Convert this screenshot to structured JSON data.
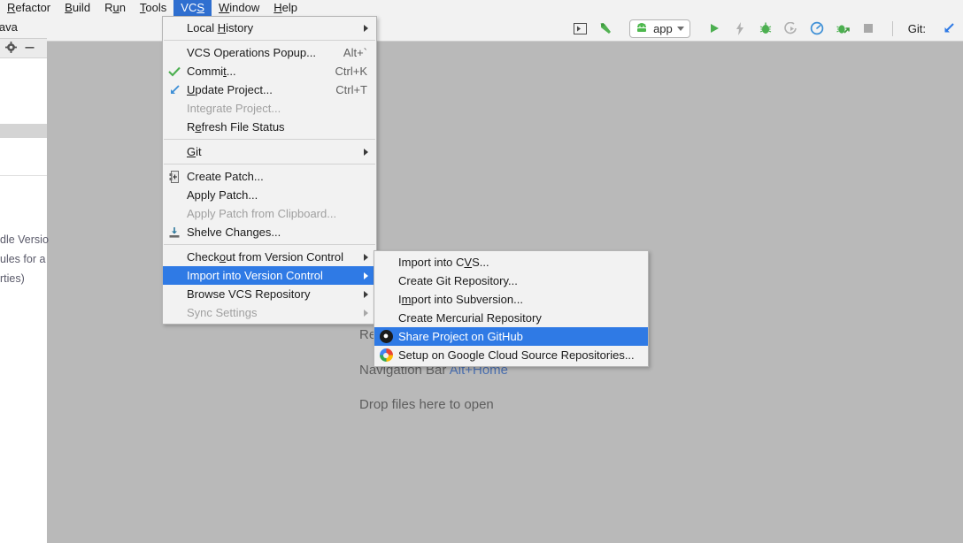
{
  "menubar": {
    "items": [
      {
        "label": "Refactor",
        "mnemonic": "R",
        "active": false
      },
      {
        "label": "Build",
        "mnemonic": "B",
        "active": false
      },
      {
        "label": "Run",
        "mnemonic": "u",
        "active": false
      },
      {
        "label": "Tools",
        "mnemonic": "T",
        "active": false
      },
      {
        "label": "VCS",
        "mnemonic": "S",
        "active": true
      },
      {
        "label": "Window",
        "mnemonic": "W",
        "active": false
      },
      {
        "label": "Help",
        "mnemonic": "H",
        "active": false
      }
    ]
  },
  "toolbar": {
    "icons": [
      "open-in-window-icon",
      "build-hammer-icon"
    ],
    "run_config": {
      "icon": "android-head-icon",
      "label": "app",
      "dropdown_icon": "chevron-down-icon"
    },
    "actions": [
      "run-icon",
      "apply-changes-icon",
      "debug-icon",
      "attach-debugger-icon",
      "profiler-icon",
      "debug-attach-icon",
      "stop-icon"
    ],
    "git_label": "Git:",
    "git_icon": "update-project-arrow-icon"
  },
  "left_panel": {
    "tab_label": "java",
    "icons": [
      "gear-icon",
      "minimize-icon"
    ],
    "clipped_text": [
      "dle Versio",
      "ules for a",
      "rties)"
    ]
  },
  "editor_hints": {
    "partial_line": "Re",
    "navigation_bar": {
      "label": "Navigation Bar",
      "shortcut": "Alt+Home"
    },
    "drop_files": "Drop files here to open"
  },
  "vcs_menu": {
    "items": [
      {
        "label": "Local History",
        "mnemonic": "H",
        "shortcut": "",
        "icon": "",
        "submenu": true,
        "disabled": false,
        "selected": false
      },
      {
        "separator": true
      },
      {
        "label": "VCS Operations Popup...",
        "mnemonic": "",
        "shortcut": "Alt+`",
        "icon": "",
        "submenu": false,
        "disabled": false,
        "selected": false
      },
      {
        "label": "Commit...",
        "mnemonic": "t",
        "shortcut": "Ctrl+K",
        "icon": "checkmark-icon",
        "submenu": false,
        "disabled": false,
        "selected": false
      },
      {
        "label": "Update Project...",
        "mnemonic": "U",
        "shortcut": "Ctrl+T",
        "icon": "update-arrow-icon",
        "submenu": false,
        "disabled": false,
        "selected": false
      },
      {
        "label": "Integrate Project...",
        "mnemonic": "",
        "shortcut": "",
        "icon": "",
        "submenu": false,
        "disabled": true,
        "selected": false
      },
      {
        "label": "Refresh File Status",
        "mnemonic": "e",
        "shortcut": "",
        "icon": "",
        "submenu": false,
        "disabled": false,
        "selected": false
      },
      {
        "separator": true
      },
      {
        "label": "Git",
        "mnemonic": "G",
        "shortcut": "",
        "icon": "",
        "submenu": true,
        "disabled": false,
        "selected": false
      },
      {
        "separator": true
      },
      {
        "label": "Create Patch...",
        "mnemonic": "",
        "shortcut": "",
        "icon": "patch-file-icon",
        "submenu": false,
        "disabled": false,
        "selected": false
      },
      {
        "label": "Apply Patch...",
        "mnemonic": "",
        "shortcut": "",
        "icon": "",
        "submenu": false,
        "disabled": false,
        "selected": false
      },
      {
        "label": "Apply Patch from Clipboard...",
        "mnemonic": "",
        "shortcut": "",
        "icon": "",
        "submenu": false,
        "disabled": true,
        "selected": false
      },
      {
        "label": "Shelve Changes...",
        "mnemonic": "",
        "shortcut": "",
        "icon": "shelve-icon",
        "submenu": false,
        "disabled": false,
        "selected": false
      },
      {
        "separator": true
      },
      {
        "label": "Checkout from Version Control",
        "mnemonic": "o",
        "shortcut": "",
        "icon": "",
        "submenu": true,
        "disabled": false,
        "selected": false
      },
      {
        "label": "Import into Version Control",
        "mnemonic": "",
        "shortcut": "",
        "icon": "",
        "submenu": true,
        "disabled": false,
        "selected": true
      },
      {
        "label": "Browse VCS Repository",
        "mnemonic": "",
        "shortcut": "",
        "icon": "",
        "submenu": true,
        "disabled": false,
        "selected": false
      },
      {
        "label": "Sync Settings",
        "mnemonic": "",
        "shortcut": "",
        "icon": "",
        "submenu": true,
        "disabled": true,
        "selected": false
      }
    ]
  },
  "import_submenu": {
    "items": [
      {
        "label": "Import into CVS...",
        "mnemonic": "V",
        "icon": "",
        "selected": false
      },
      {
        "label": "Create Git Repository...",
        "mnemonic": "",
        "icon": "",
        "selected": false
      },
      {
        "label": "Import into Subversion...",
        "mnemonic": "m",
        "icon": "",
        "selected": false
      },
      {
        "label": "Create Mercurial Repository",
        "mnemonic": "",
        "icon": "",
        "selected": false
      },
      {
        "label": "Share Project on GitHub",
        "mnemonic": "",
        "icon": "github-icon",
        "selected": true
      },
      {
        "label": "Setup on Google Cloud Source Repositories...",
        "mnemonic": "",
        "icon": "google-cloud-icon",
        "selected": false
      }
    ]
  },
  "colors": {
    "menubar_bg": "#f2f2f2",
    "menu_bg": "#f2f2f2",
    "selection_blue": "#2f7ae5",
    "menubar_selection_blue": "#2f6fd0",
    "editor_bg": "#b9b9b9",
    "link_blue": "#4a6fb0",
    "disabled_gray": "#a0a0a0"
  }
}
